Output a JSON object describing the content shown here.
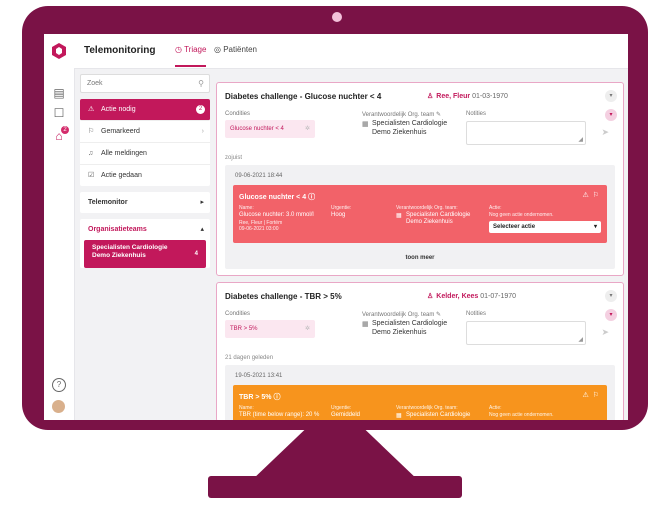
{
  "app": {
    "title": "Telemonitoring",
    "tabs": [
      {
        "label": "Triage",
        "icon": "clock-icon",
        "active": true
      },
      {
        "label": "Patiënten",
        "icon": "people-icon",
        "active": false
      }
    ]
  },
  "rail": {
    "icons": [
      "logo-icon",
      "id-card-icon",
      "chat-icon",
      "home-icon",
      "help-icon",
      "avatar"
    ],
    "home_badge": "2"
  },
  "sidebar": {
    "search_placeholder": "Zoek",
    "items": [
      {
        "label": "Actie nodig",
        "icon": "warning-icon",
        "count": "2",
        "active": true
      },
      {
        "label": "Gemarkeerd",
        "icon": "bookmark-icon",
        "chevron": "›"
      },
      {
        "label": "Alle meldingen",
        "icon": "bell-icon"
      },
      {
        "label": "Actie gedaan",
        "icon": "check-icon"
      }
    ],
    "telemonitor_label": "Telemonitor",
    "orgteams_label": "Organisatieteams",
    "team": {
      "line1": "Specialisten Cardiologie",
      "line2": "Demo Ziekenhuis",
      "count": "4"
    }
  },
  "cards": [
    {
      "title": "Diabetes challenge - Glucose nuchter < 4",
      "patient": "Ree, Fleur",
      "dob": "01-03-1970",
      "conditions_label": "Condities",
      "condition": "Glucose nuchter < 4",
      "team_label": "Verantwoordelijk Org. team",
      "team_line1": "Specialisten Cardiologie",
      "team_line2": "Demo Ziekenhuis",
      "notes_label": "Notities",
      "ago": "zojuist",
      "timestamp": "09-06-2021 18:44",
      "alert": {
        "title": "Glucose nuchter < 4",
        "h_name": "Name:",
        "h_urgency": "Urgentie:",
        "h_team": "Verantwoordelijk Org. team:",
        "h_action": "Actie:",
        "value": "Glucose nuchter: 3.0 mmol/l",
        "sub1": "Ree, Fleur | Fortém",
        "sub2": "09-06-2021 03:00",
        "urgency": "Hoog",
        "team1": "Specialisten Cardiologie",
        "team2": "Demo Ziekenhuis",
        "action_hint": "Nog geen actie ondernomen.",
        "select": "Selecteer actie"
      },
      "more": "toon meer"
    },
    {
      "title": "Diabetes challenge - TBR > 5%",
      "patient": "Kelder, Kees",
      "dob": "01-07-1970",
      "conditions_label": "Condities",
      "condition": "TBR > 5%",
      "team_label": "Verantwoordelijk Org. team",
      "team_line1": "Specialisten Cardiologie",
      "team_line2": "Demo Ziekenhuis",
      "notes_label": "Notities",
      "ago": "21 dagen geleden",
      "timestamp": "19-05-2021 13:41",
      "alert": {
        "title": "TBR > 5%",
        "h_name": "Name:",
        "h_urgency": "Urgentie:",
        "h_team": "Verantwoordelijk Org. team:",
        "h_action": "Actie:",
        "value": "TBR (time below range): 20 %",
        "urgency": "Gemiddeld",
        "team1": "Specialisten Cardiologie",
        "action_hint": "Nog geen actie ondernomen."
      }
    }
  ],
  "colors": {
    "brand": "#7a1246",
    "accent": "#c2185b",
    "alert_red": "#f26269",
    "alert_orange": "#f7941d"
  }
}
